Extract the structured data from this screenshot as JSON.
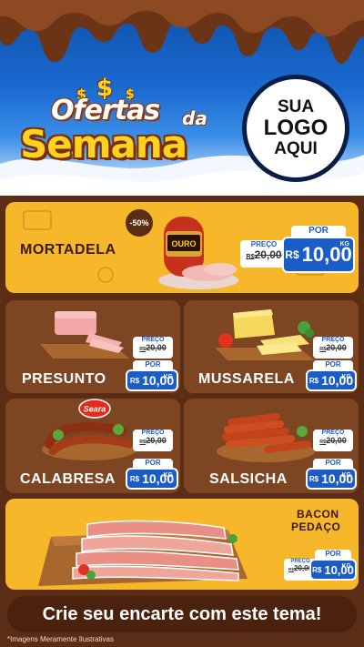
{
  "header": {
    "title_line1": "Ofertas",
    "title_da": "da",
    "title_line2": "Semana",
    "logo": {
      "line1": "SUA",
      "line2": "LOGO",
      "line3": "AQUI"
    }
  },
  "products": [
    {
      "name": "MORTADELA",
      "badge": "-50%",
      "old_label": "PREÇO",
      "old_currency": "R$",
      "old_value": "20,00",
      "por_label": "POR",
      "new_currency": "R$",
      "new_value": "10,00",
      "unit": "KG",
      "brand": "OURO"
    },
    {
      "name": "PRESUNTO",
      "old_label": "PREÇO",
      "old_currency": "R$",
      "old_value": "20,00",
      "por_label": "POR",
      "new_currency": "R$",
      "new_value": "10,00",
      "unit": "KG"
    },
    {
      "name": "MUSSARELA",
      "old_label": "PREÇO",
      "old_currency": "R$",
      "old_value": "20,00",
      "por_label": "POR",
      "new_currency": "R$",
      "new_value": "10,00",
      "unit": "KG"
    },
    {
      "name": "CALABRESA",
      "old_label": "PREÇO",
      "old_currency": "R$",
      "old_value": "20,00",
      "por_label": "POR",
      "new_currency": "R$",
      "new_value": "10,00",
      "unit": "KG",
      "brand": "Seara"
    },
    {
      "name": "SALSICHA",
      "old_label": "PREÇO",
      "old_currency": "R$",
      "old_value": "20,00",
      "por_label": "POR",
      "new_currency": "R$",
      "new_value": "10,00",
      "unit": "KG"
    },
    {
      "name_line1": "BACON",
      "name_line2": "PEDAÇO",
      "old_label": "PREÇO",
      "old_currency": "R$",
      "old_value": "20,00",
      "por_label": "POR",
      "new_currency": "R$",
      "new_value": "10,00",
      "unit": "KG"
    }
  ],
  "cta": "Crie seu encarte com este tema!",
  "disclaimer": "*Imagens Meramente Ilustrativas",
  "colors": {
    "blue": "#1b5cc7",
    "yellow": "#f6b72a",
    "brown": "#7e4523",
    "dark_brown": "#5a2d14",
    "gold": "#ffd21f"
  }
}
